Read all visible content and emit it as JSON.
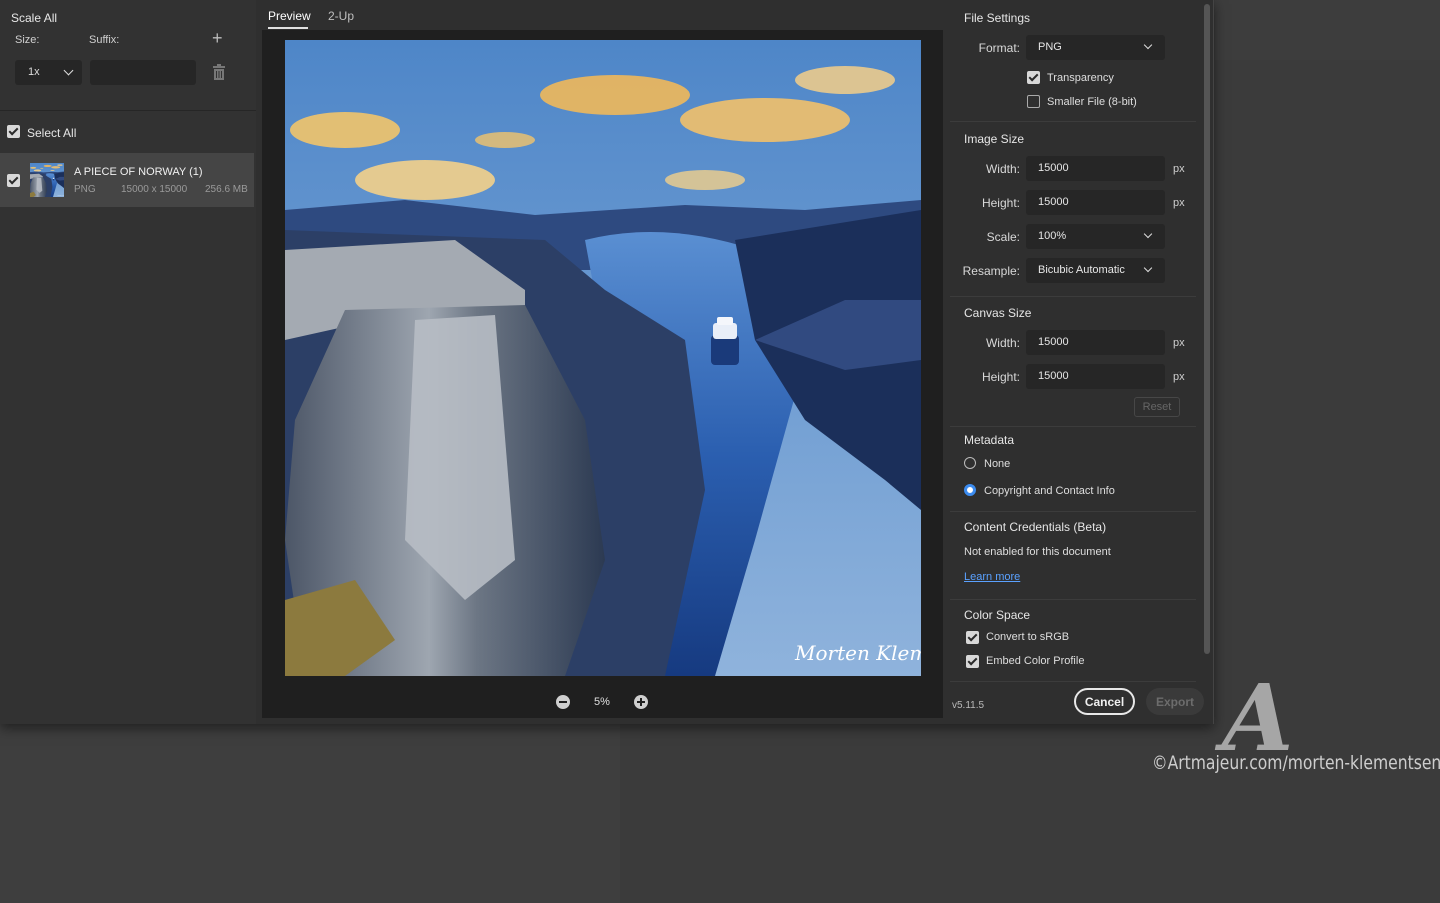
{
  "left_panel": {
    "title": "Scale All",
    "size_label": "Size:",
    "suffix_label": "Suffix:",
    "scale_value": "1x",
    "suffix_value": "",
    "select_all_label": "Select All",
    "asset": {
      "name": "A PIECE OF NORWAY (1)",
      "format": "PNG",
      "dimensions": "15000 x 15000",
      "filesize": "256.6 MB"
    }
  },
  "tabs": [
    {
      "label": "Preview",
      "active": true
    },
    {
      "label": "2-Up",
      "active": false
    }
  ],
  "preview": {
    "zoom": "5%"
  },
  "file_settings": {
    "title": "File Settings",
    "format_label": "Format:",
    "format_value": "PNG",
    "transparency_label": "Transparency",
    "transparency_checked": true,
    "smaller_file_label": "Smaller File (8-bit)",
    "smaller_file_checked": false
  },
  "image_size": {
    "title": "Image Size",
    "width_label": "Width:",
    "width_value": "15000",
    "height_label": "Height:",
    "height_value": "15000",
    "scale_label": "Scale:",
    "scale_value": "100%",
    "resample_label": "Resample:",
    "resample_value": "Bicubic Automatic",
    "unit": "px"
  },
  "canvas_size": {
    "title": "Canvas Size",
    "width_label": "Width:",
    "width_value": "15000",
    "height_label": "Height:",
    "height_value": "15000",
    "unit": "px",
    "reset_label": "Reset"
  },
  "metadata": {
    "title": "Metadata",
    "options": [
      {
        "label": "None",
        "selected": false
      },
      {
        "label": "Copyright and Contact Info",
        "selected": true
      }
    ]
  },
  "content_credentials": {
    "title": "Content Credentials (Beta)",
    "status": "Not enabled for this document",
    "link": "Learn more"
  },
  "color_space": {
    "title": "Color Space",
    "convert_label": "Convert to sRGB",
    "convert_checked": true,
    "embed_label": "Embed Color Profile",
    "embed_checked": true
  },
  "footer": {
    "version": "v5.11.5",
    "cancel_label": "Cancel",
    "export_label": "Export"
  },
  "background": {
    "watermark": "©Artmajeur.com/morten-klementsen",
    "watermark_logo": "A"
  },
  "colors": {
    "accent": "#3c8cf0",
    "link": "#5aa1ff",
    "dialog_bg": "#2f2f2f",
    "preview_bg": "#1f1f1f"
  }
}
